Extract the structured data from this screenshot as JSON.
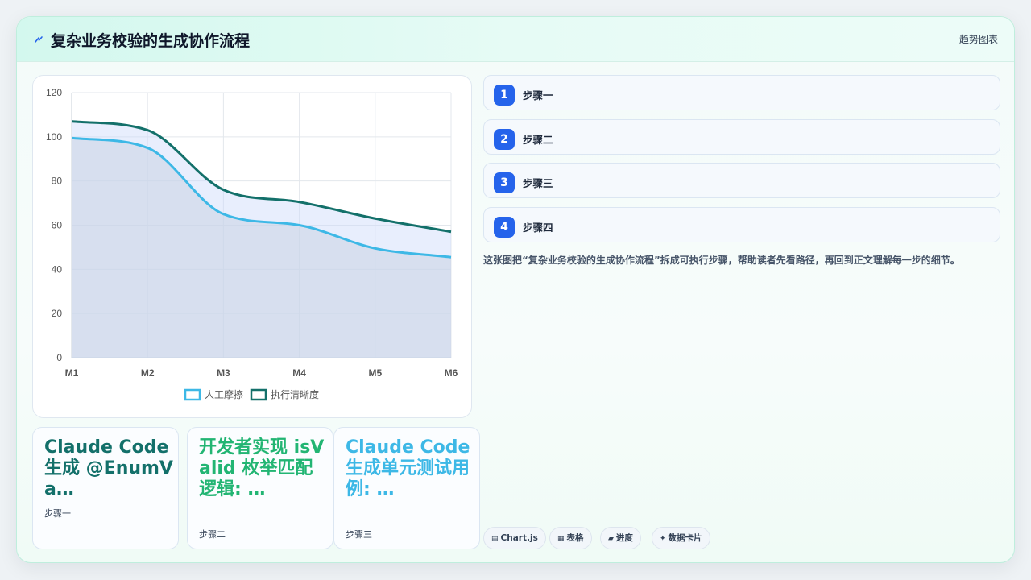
{
  "header": {
    "title": "复杂业务校验的生成协作流程",
    "right_label": "趋势图表",
    "icon": "lightning-icon"
  },
  "chart_data": {
    "type": "area",
    "categories": [
      "M1",
      "M2",
      "M3",
      "M4",
      "M5",
      "M6"
    ],
    "series": [
      {
        "name": "人工摩擦",
        "values": [
          99.5,
          95,
          65,
          60,
          49.5,
          45.5
        ],
        "color": "#3db8e6"
      },
      {
        "name": "执行清晰度",
        "values": [
          107,
          103,
          76,
          70.5,
          63,
          57
        ],
        "color": "#13706a"
      }
    ],
    "ylim": [
      0,
      120
    ],
    "yticks": [
      0,
      20,
      40,
      60,
      80,
      100,
      120
    ],
    "grid": true,
    "legend": "bottom"
  },
  "steps": [
    {
      "num": "1",
      "label": "步骤一"
    },
    {
      "num": "2",
      "label": "步骤二"
    },
    {
      "num": "3",
      "label": "步骤三"
    },
    {
      "num": "4",
      "label": "步骤四"
    }
  ],
  "caption": "这张图把“复杂业务校验的生成协作流程”拆成可执行步骤，帮助读者先看路径，再回到正文理解每一步的细节。",
  "cards": [
    {
      "title": "Claude Code 生成 @EnumVa…",
      "sub": "步骤一",
      "color": "#13706a"
    },
    {
      "title": "开发者实现 isValid 枚举匹配逻辑: …",
      "sub": "步骤二",
      "color": "#22b573"
    },
    {
      "title": "Claude Code 生成单元测试用例: …",
      "sub": "步骤三",
      "color": "#3db8e6"
    }
  ],
  "tags": [
    {
      "icon": "▤",
      "label": "Chart.js",
      "icon_name": "chart-icon"
    },
    {
      "icon": "▦",
      "label": "表格",
      "icon_name": "table-icon"
    },
    {
      "icon": "▰",
      "label": "进度",
      "icon_name": "progress-icon"
    },
    {
      "icon": "✦",
      "label": "数据卡片",
      "icon_name": "sparkle-icon"
    }
  ]
}
